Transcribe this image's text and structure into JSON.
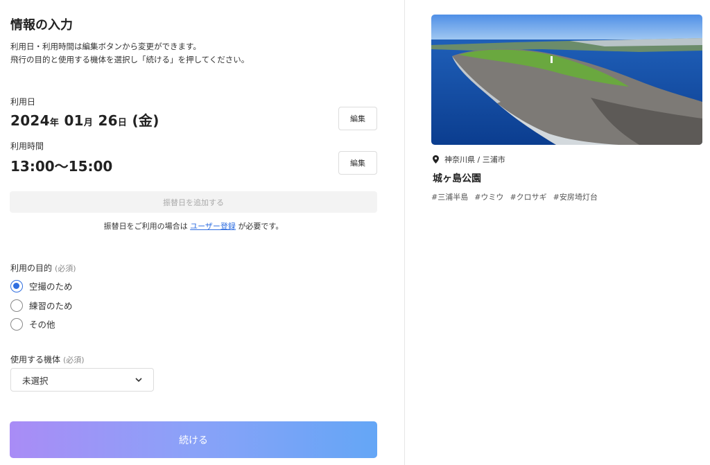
{
  "page": {
    "title": "情報の入力",
    "intro_line1": "利用日・利用時間は編集ボタンから変更ができます。",
    "intro_line2": "飛行の目的と使用する機体を選択し「続ける」を押してください。"
  },
  "date": {
    "label": "利用日",
    "year": "2024",
    "year_unit": "年",
    "month": "01",
    "month_unit": "月",
    "day": "26",
    "day_unit": "日",
    "weekday": "(金)",
    "edit_label": "編集"
  },
  "time": {
    "label": "利用時間",
    "value": "13:00～15:00",
    "edit_label": "編集"
  },
  "alternate": {
    "button_label": "振替日を追加する",
    "note_prefix": "振替日をご利用の場合は",
    "note_link": "ユーザー登録",
    "note_suffix": "が必要です。"
  },
  "purpose": {
    "label": "利用の目的",
    "required": "(必須)",
    "options": [
      {
        "label": "空撮のため",
        "checked": true
      },
      {
        "label": "練習のため",
        "checked": false
      },
      {
        "label": "その他",
        "checked": false
      }
    ]
  },
  "aircraft": {
    "label": "使用する機体",
    "required": "(必須)",
    "selected": "未選択"
  },
  "continue_label": "続ける",
  "spot": {
    "location": "神奈川県 / 三浦市",
    "name": "城ヶ島公園",
    "tags": [
      "#三浦半島",
      "#ウミウ",
      "#クロサギ",
      "#安房埼灯台"
    ]
  },
  "colors": {
    "accent": "#2f6ee0",
    "button_gradient_start": "#a98cf6",
    "button_gradient_end": "#64a6f6"
  }
}
